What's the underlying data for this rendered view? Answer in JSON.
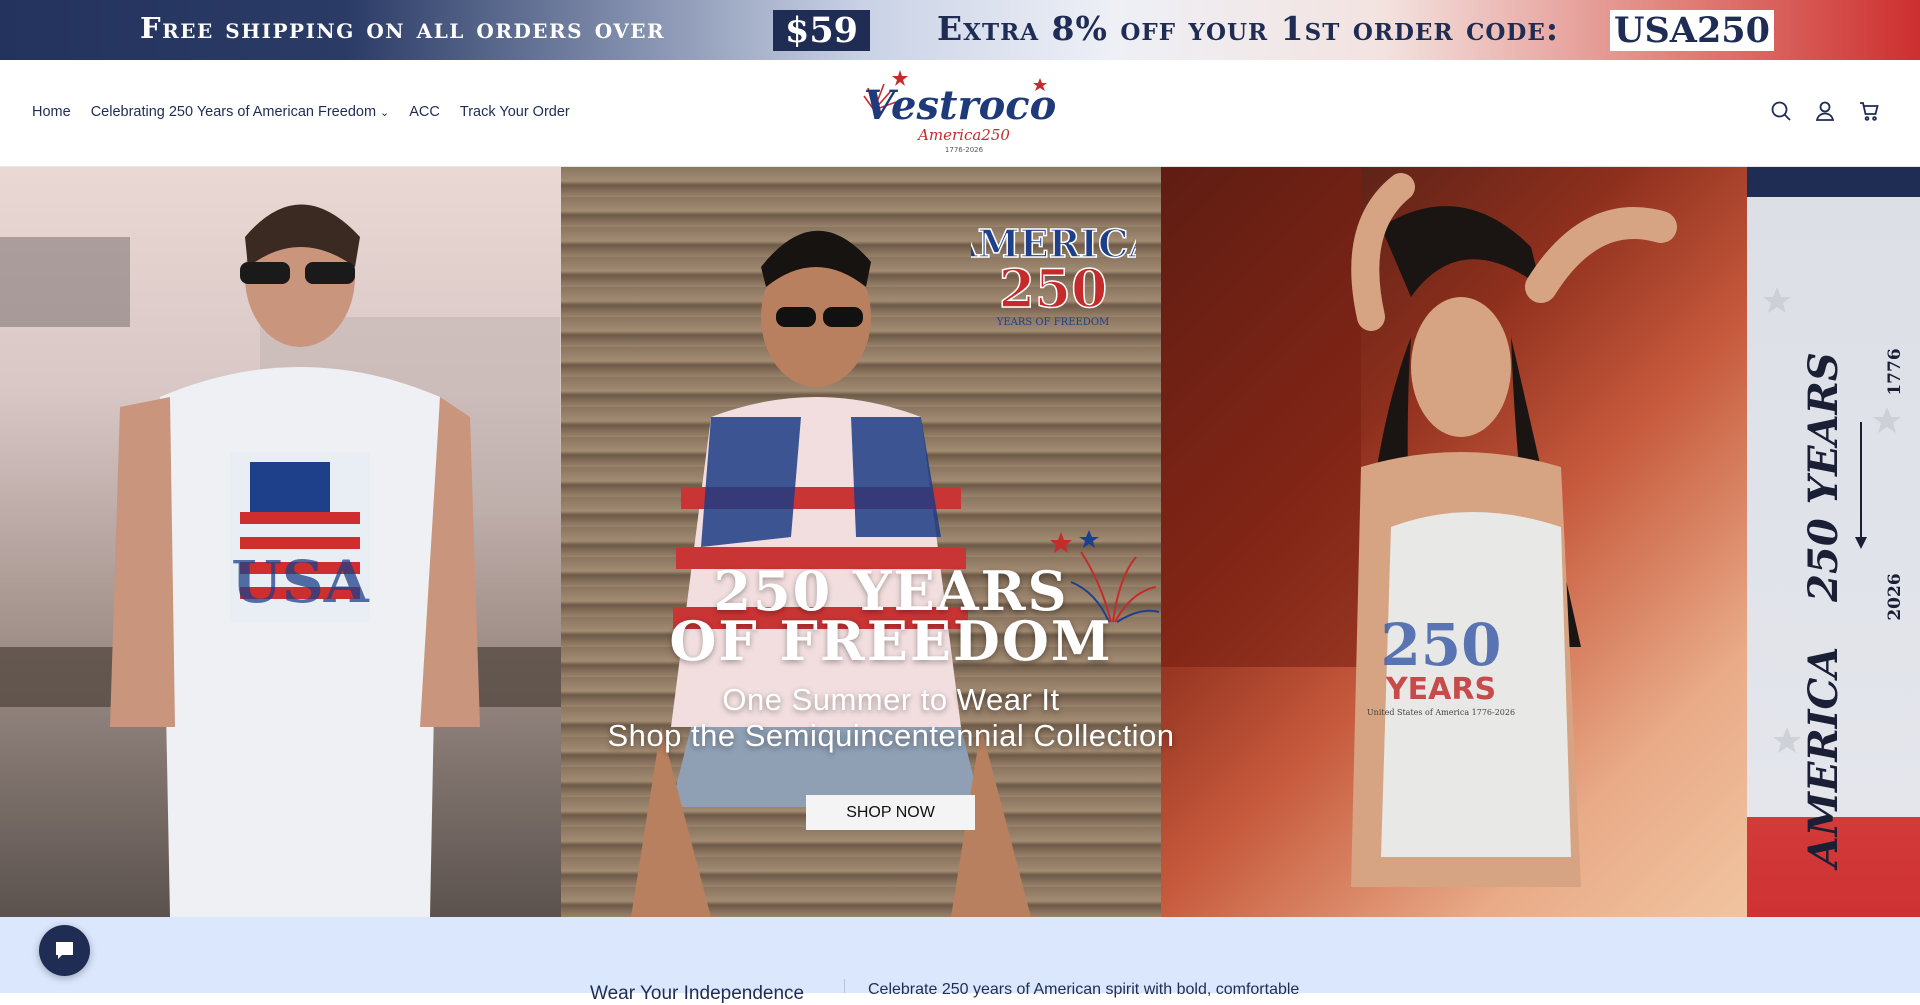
{
  "promo": {
    "text_left": "Free shipping on all orders over",
    "threshold": "$59",
    "text_right": "Extra 8% off your 1st order code:",
    "code": "USA250"
  },
  "nav": {
    "items": [
      "Home",
      "Celebrating 250 Years of American Freedom",
      "ACC",
      "Track Your Order"
    ]
  },
  "logo": {
    "brand": "Vestroco",
    "tagline": "America250",
    "years": "1776-2026"
  },
  "hero": {
    "badge_top": "AMERICA",
    "badge_num": "250",
    "badge_sub": "YEARS OF FREEDOM",
    "headline_1": "250 YEARS",
    "headline_2": "OF FREEDOM",
    "sub_1": "One Summer to Wear It",
    "sub_2": "Shop the Semiquincentennial Collection",
    "cta": "SHOP NOW",
    "shirt_left": "USA",
    "shirt_right_num": "250",
    "shirt_right_word": "YEARS",
    "shirt_right_sub": "United States of America 1776-2026",
    "side_1": "250 YEARS",
    "side_2": "AMERICA",
    "side_year_a": "1776",
    "side_year_b": "2026"
  },
  "intro": {
    "left": "Wear Your Independence",
    "right": "Celebrate 250 years of American spirit with bold, comfortable"
  },
  "colors": {
    "navy": "#1f2d54",
    "red": "#cc2f2f",
    "band": "#dbe7fd"
  }
}
